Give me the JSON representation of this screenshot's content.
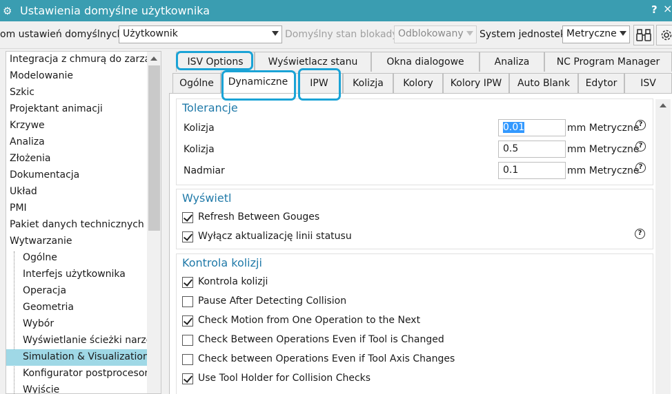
{
  "window": {
    "title": "Ustawienia domyślne użytkownika",
    "help": "?",
    "close": "×"
  },
  "toolbar": {
    "scope_label": "om ustawień domyślnych",
    "scope_value": "Użytkownik",
    "lock_label": "Domyślny stan blokady",
    "lock_value": "Odblokowany",
    "units_label": "System jednostek",
    "units_value": "Metryczne"
  },
  "tree": {
    "items": [
      {
        "label": "Integracja z chmurą do zarząd"
      },
      {
        "label": "Modelowanie"
      },
      {
        "label": "Szkic"
      },
      {
        "label": "Projektant animacji"
      },
      {
        "label": "Krzywe"
      },
      {
        "label": "Analiza"
      },
      {
        "label": "Złożenia"
      },
      {
        "label": "Dokumentacja"
      },
      {
        "label": "Układ"
      },
      {
        "label": "PMI"
      },
      {
        "label": "Pakiet danych technicznych"
      },
      {
        "label": "Wytwarzanie"
      }
    ],
    "children": [
      {
        "label": "Ogólne"
      },
      {
        "label": "Interfejs użytkownika"
      },
      {
        "label": "Operacja"
      },
      {
        "label": "Geometria"
      },
      {
        "label": "Wybór"
      },
      {
        "label": "Wyświetlanie ścieżki narzęc"
      },
      {
        "label": "Simulation & Visualization"
      },
      {
        "label": "Konfigurator postprocesora"
      },
      {
        "label": "Wyjście"
      }
    ]
  },
  "tabs": {
    "row1": [
      "ISV Options",
      "Wyświetlacz stanu",
      "Okna dialogowe",
      "Analiza",
      "NC Program Manager"
    ],
    "row2": [
      "Ogólne",
      "Dynamiczne",
      "IPW",
      "Kolizja",
      "Kolory",
      "Kolory IPW",
      "Auto Blank",
      "Edytor",
      "ISV"
    ]
  },
  "tolerance": {
    "title": "Tolerancje",
    "rows": [
      {
        "label": "Kolizja",
        "value": "0.01",
        "unit": "mm",
        "system": "Metryczne"
      },
      {
        "label": "Kolizja",
        "value": "0.5",
        "unit": "mm",
        "system": "Metryczne"
      },
      {
        "label": "Nadmiar",
        "value": "0.1",
        "unit": "mm",
        "system": "Metryczne"
      }
    ]
  },
  "display": {
    "title": "Wyświetl",
    "items": [
      {
        "label": "Refresh Between Gouges",
        "checked": true
      },
      {
        "label": "Wyłącz aktualizację linii statusu",
        "checked": true
      }
    ]
  },
  "collision": {
    "title": "Kontrola kolizji",
    "items": [
      {
        "label": "Kontrola kolizji",
        "checked": true
      },
      {
        "label": "Pause After Detecting Collision",
        "checked": false
      },
      {
        "label": "Check Motion from One Operation to the Next",
        "checked": true
      },
      {
        "label": "Check Between Operations Even if Tool is Changed",
        "checked": false
      },
      {
        "label": "Check between Operations Even if Tool Axis Changes",
        "checked": false
      },
      {
        "label": "Use Tool Holder for Collision Checks",
        "checked": true
      }
    ]
  },
  "colors": {
    "titlebar": "#3a9db1",
    "highlight": "#1aa3d6",
    "group_title": "#1f79a8",
    "tree_selected": "#9fd8e6"
  },
  "icons": {
    "title": "gear-icon",
    "search": "binoculars-icon",
    "settings": "gear-icon",
    "help": "question-circle-icon"
  }
}
